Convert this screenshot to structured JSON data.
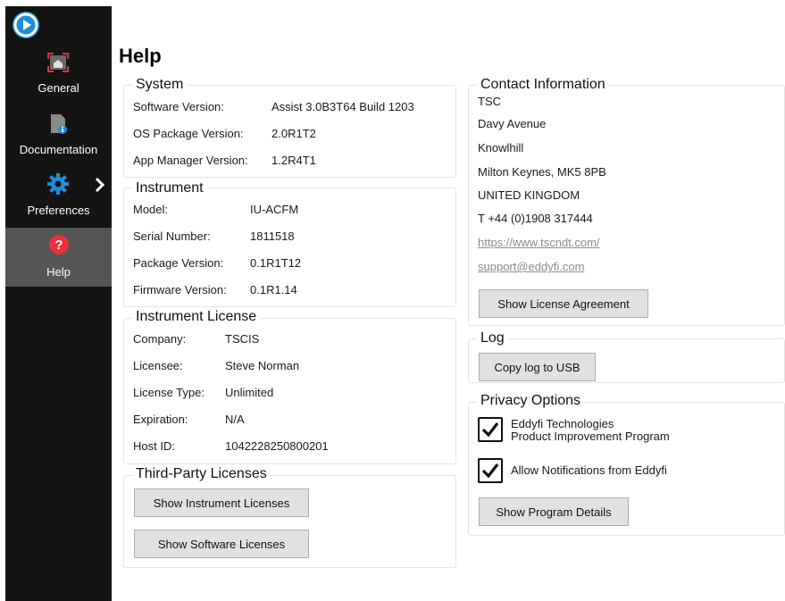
{
  "page": {
    "title": "Help"
  },
  "sidebar": {
    "items": [
      {
        "label": "General",
        "icon": "home-screen-icon"
      },
      {
        "label": "Documentation",
        "icon": "document-info-icon"
      },
      {
        "label": "Preferences",
        "icon": "gear-icon"
      },
      {
        "label": "Help",
        "icon": "help-icon",
        "active": true
      }
    ]
  },
  "system": {
    "title": "System",
    "rows": [
      {
        "label": "Software Version:",
        "value": "Assist 3.0B3T64 Build 1203"
      },
      {
        "label": "OS Package Version:",
        "value": "2.0R1T2"
      },
      {
        "label": "App Manager Version:",
        "value": "1.2R4T1"
      }
    ]
  },
  "instrument": {
    "title": "Instrument",
    "rows": [
      {
        "label": "Model:",
        "value": "IU-ACFM"
      },
      {
        "label": "Serial Number:",
        "value": "1811518"
      },
      {
        "label": "Package Version:",
        "value": "0.1R1T12"
      },
      {
        "label": "Firmware Version:",
        "value": "0.1R1.14"
      }
    ]
  },
  "license": {
    "title": "Instrument License",
    "rows": [
      {
        "label": "Company:",
        "value": "TSCIS"
      },
      {
        "label": "Licensee:",
        "value": "Steve Norman"
      },
      {
        "label": "License Type:",
        "value": "Unlimited"
      },
      {
        "label": "Expiration:",
        "value": "N/A"
      },
      {
        "label": "Host ID:",
        "value": "1042228250800201"
      }
    ]
  },
  "third_party": {
    "title": "Third-Party Licenses",
    "instrument_button": "Show Instrument Licenses",
    "software_button": "Show Software Licenses"
  },
  "contact": {
    "title": "Contact Information",
    "lines": [
      "TSC",
      "Davy Avenue",
      "Knowlhill",
      "Milton Keynes, MK5 8PB",
      "UNITED KINGDOM",
      "T +44 (0)1908 317444"
    ],
    "website": "https://www.tscndt.com/",
    "email": "support@eddyfi.com",
    "license_button": "Show License Agreement"
  },
  "log": {
    "title": "Log",
    "copy_button": "Copy log to USB"
  },
  "privacy": {
    "title": "Privacy Options",
    "improvement_line1": "Eddyfi Technologies",
    "improvement_line2": "Product Improvement Program",
    "improvement_checked": true,
    "notifications_label": "Allow Notifications from Eddyfi",
    "notifications_checked": true,
    "details_button": "Show Program Details"
  },
  "colors": {
    "sidebar_bg": "#141414",
    "active_item_bg": "#555555",
    "accent_blue": "#1e8fd6",
    "help_red": "#e8323c",
    "general_red": "#d9363e"
  }
}
